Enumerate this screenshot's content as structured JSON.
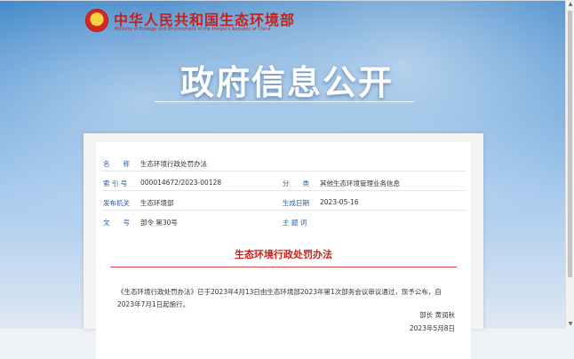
{
  "header": {
    "site_title": "中华人民共和国生态环境部",
    "site_subtitle": "Ministry of Ecology and Environment of the People's Republic of China",
    "banner_title": "政府信息公开"
  },
  "meta": {
    "name_label": "名　　称",
    "name_value": "生态环境行政处罚办法",
    "index_label": "索 引 号",
    "index_value": "000014672/2023-00128",
    "category_label": "分　　类",
    "category_value": "其他生态环境管理业务信息",
    "issuer_label": "发布机关",
    "issuer_value": "生态环境部",
    "date_label": "生成日期",
    "date_value": "2023-05-16",
    "docno_label": "文　　号",
    "docno_value": "部令 第30号",
    "keywords_label": "主 题 词",
    "keywords_value": ""
  },
  "document": {
    "title": "生态环境行政处罚办法",
    "body": "《生态环境行政处罚办法》已于2023年4月13日由生态环境部2023年第1次部务会议审议通过，现予公布，自2023年7月1日起施行。",
    "signature": "部长  黄润秋",
    "date": "2023年5月8日"
  },
  "colors": {
    "brand_red": "#c9201a",
    "label_blue": "#2a5aa6"
  }
}
